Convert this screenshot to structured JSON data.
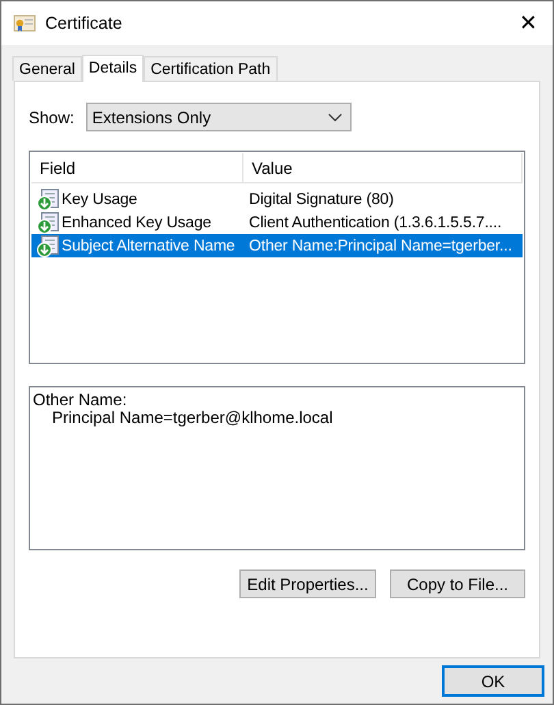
{
  "window": {
    "title": "Certificate",
    "close": "✕"
  },
  "tabs": [
    {
      "label": "General",
      "selected": false
    },
    {
      "label": "Details",
      "selected": true
    },
    {
      "label": "Certification Path",
      "selected": false
    }
  ],
  "show": {
    "label": "Show:",
    "value": "Extensions Only"
  },
  "table": {
    "columns": [
      "Field",
      "Value"
    ],
    "rows": [
      {
        "field": "Key Usage",
        "value": "Digital Signature (80)",
        "selected": false
      },
      {
        "field": "Enhanced Key Usage",
        "value": "Client Authentication (1.3.6.1.5.5.7....",
        "selected": false
      },
      {
        "field": "Subject Alternative Name",
        "value": "Other Name:Principal Name=tgerber...",
        "selected": true
      }
    ]
  },
  "details": [
    "Other Name:",
    "Principal Name=tgerber@klhome.local"
  ],
  "buttons": [
    "Edit Properties...",
    "Copy to File..."
  ],
  "ok": "OK"
}
